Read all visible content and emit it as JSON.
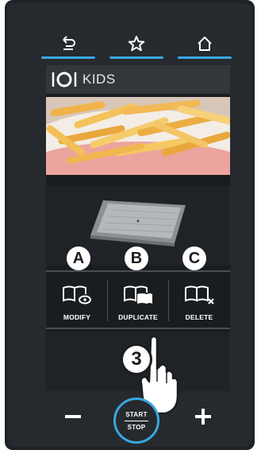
{
  "nav": {
    "items": [
      {
        "name": "back",
        "icon": "back-arrow-icon"
      },
      {
        "name": "favorite",
        "icon": "star-icon"
      },
      {
        "name": "home",
        "icon": "home-icon"
      }
    ],
    "accent_color": "#3aa7e0"
  },
  "header": {
    "icon": "cutlery-plate-icon",
    "title": "KIDS"
  },
  "image": {
    "subject": "french-fries-photo"
  },
  "tray": {
    "icon": "baking-tray-icon"
  },
  "badges": [
    "A",
    "B",
    "C"
  ],
  "actions": [
    {
      "label": "MODIFY",
      "icon": "book-eye-icon"
    },
    {
      "label": "DUPLICATE",
      "icon": "book-copy-icon"
    },
    {
      "label": "DELETE",
      "icon": "book-x-icon"
    }
  ],
  "callout": {
    "step": "3",
    "icon": "pointing-hand-icon"
  },
  "controls": {
    "minus_icon": "minus-icon",
    "plus_icon": "plus-icon",
    "start_label": "START",
    "stop_label": "STOP"
  }
}
